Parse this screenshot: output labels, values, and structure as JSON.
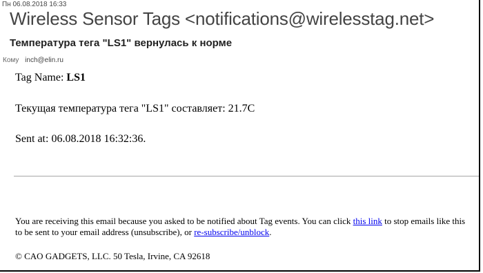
{
  "email": {
    "date": "Пн 06.08.2018 16:33",
    "sender": "Wireless Sensor Tags <notifications@wirelesstag.net>",
    "subject": "Температура тега \"LS1\" вернулась к норме",
    "to_label": "Кому",
    "to_value": "inch@elin.ru"
  },
  "body": {
    "tag_name_label": "Tag Name: ",
    "tag_name_value": "LS1",
    "temperature_line": "Текущая температура тега \"LS1\" составляет: 21.7C",
    "sent_at": "Sent at: 06.08.2018 16:32:36.",
    "notice_part1": "You are receiving this email because you asked to be notified about Tag events. You can click ",
    "notice_link1": "this link",
    "notice_part2": " to stop emails like this to be sent to your email address (unsubscribe), or ",
    "notice_link2": "re-subscribe/unblock",
    "notice_part3": ".",
    "copyright": "© CAO GADGETS, LLC. 50 Tesla, Irvine, CA 92618"
  },
  "colors": {
    "link": "#0000ee",
    "header_text": "#444444",
    "divider": "#a6a6a6"
  }
}
